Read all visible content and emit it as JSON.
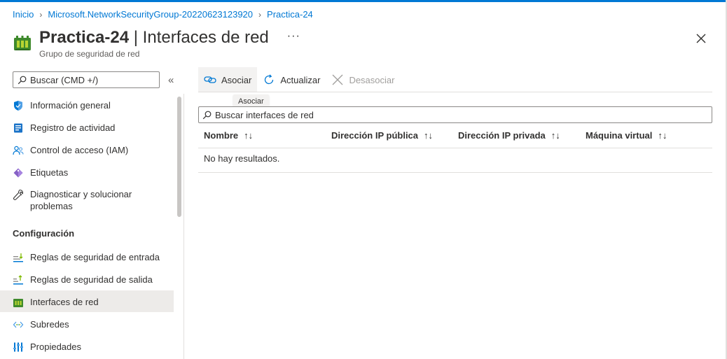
{
  "breadcrumb": {
    "items": [
      "Inicio",
      "Microsoft.NetworkSecurityGroup-20220623123920",
      "Practica-24"
    ]
  },
  "header": {
    "resource_name": "Practica-24",
    "separator": "|",
    "blade_title": "Interfaces de red",
    "subtitle": "Grupo de seguridad de red",
    "more_label": "···"
  },
  "sidebar": {
    "search_placeholder": "Buscar (CMD +/)",
    "collapse_label": "«",
    "items_top": [
      {
        "label": "Información general",
        "icon": "shield-icon"
      },
      {
        "label": "Registro de actividad",
        "icon": "activity-log-icon"
      },
      {
        "label": "Control de acceso (IAM)",
        "icon": "people-icon"
      },
      {
        "label": "Etiquetas",
        "icon": "tag-icon"
      },
      {
        "label_line1": "Diagnosticar y solucionar",
        "label_line2": "problemas",
        "icon": "wrench-icon"
      }
    ],
    "section_title": "Configuración",
    "items_config": [
      {
        "label": "Reglas de seguridad de entrada",
        "icon": "inbound-rules-icon"
      },
      {
        "label": "Reglas de seguridad de salida",
        "icon": "outbound-rules-icon"
      },
      {
        "label": "Interfaces de red",
        "icon": "network-interface-icon",
        "active": true
      },
      {
        "label": "Subredes",
        "icon": "subnet-icon"
      },
      {
        "label": "Propiedades",
        "icon": "properties-icon"
      }
    ]
  },
  "toolbar": {
    "associate_label": "Asociar",
    "refresh_label": "Actualizar",
    "disassociate_label": "Desasociar",
    "tooltip": "Asociar"
  },
  "grid": {
    "search_placeholder": "Buscar interfaces de red",
    "columns": [
      "Nombre",
      "Dirección IP pública",
      "Dirección IP privada",
      "Máquina virtual"
    ],
    "sort_glyph": "↑↓",
    "empty_message": "No hay resultados."
  },
  "colors": {
    "accent": "#0078d4",
    "nsg_green": "#5ea0ef",
    "active_bg": "#edebe9"
  }
}
